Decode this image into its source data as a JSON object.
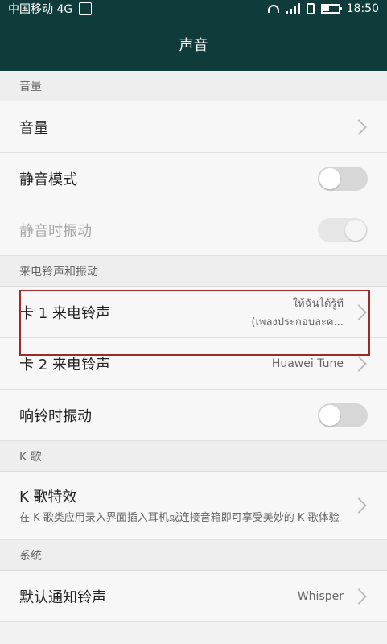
{
  "status": {
    "carrier": "中国移动 4G",
    "time": "18:50"
  },
  "header": {
    "title": "声音"
  },
  "sections": {
    "volume_header": "音量",
    "ring_header": "来电铃声和振动",
    "k_header": "K 歌",
    "system_header": "系统"
  },
  "rows": {
    "volume": "音量",
    "silent_mode": "静音模式",
    "vibrate_silent": "静音时振动",
    "sim1": "卡 1 来电铃声",
    "sim1_value_line1": "ให้ฉันได้รู้ที",
    "sim1_value_line2": "(เพลงประกอบละค...",
    "sim2": "卡 2 来电铃声",
    "sim2_value": "Huawei Tune",
    "ring_vibrate": "响铃时振动",
    "k_effect": "K 歌特效",
    "k_effect_desc": "在 K 歌类应用录入界面插入耳机或连接音箱即可享受美妙的 K 歌体验",
    "default_notification": "默认通知铃声",
    "default_notification_value": "Whisper"
  },
  "colors": {
    "header": "#0f3b3b",
    "highlight_border": "#9c2a2a"
  }
}
